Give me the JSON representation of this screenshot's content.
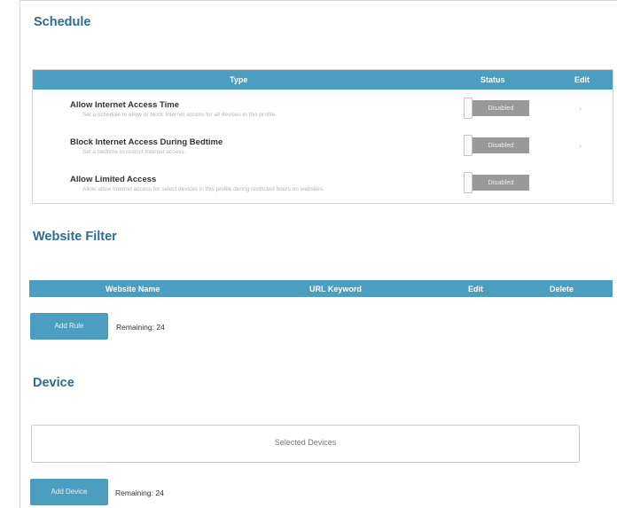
{
  "schedule": {
    "title": "Schedule",
    "headers": {
      "type": "Type",
      "status": "Status",
      "edit": "Edit"
    },
    "rows": [
      {
        "name": "Allow Internet Access Time",
        "description": "Set a schedule to allow or block Internet access for all devices in this profile.",
        "status": "Disabled",
        "edit": "›"
      },
      {
        "name": "Block Internet Access During Bedtime",
        "description": "Set a bedtime to restrict Internet access.",
        "status": "Disabled",
        "edit": "›"
      },
      {
        "name": "Allow Limited Access",
        "description": "Allow allow Internet access for select devices in this profile during restricted hours on websites.",
        "status": "Disabled",
        "edit": ""
      }
    ]
  },
  "website_filter": {
    "title": "Website Filter",
    "headers": {
      "website_name": "Website Name",
      "url_keyword": "URL Keyword",
      "edit": "Edit",
      "delete": "Delete"
    },
    "add_button": "Add Rule",
    "remaining": "Remaining: 24"
  },
  "device": {
    "title": "Device",
    "selected_devices_label": "Selected Devices",
    "add_button": "Add Device",
    "remaining": "Remaining: 24"
  },
  "colors": {
    "accent": "#4b9ec0",
    "title": "#2f6d8f",
    "toggle_disabled": "#999999"
  }
}
